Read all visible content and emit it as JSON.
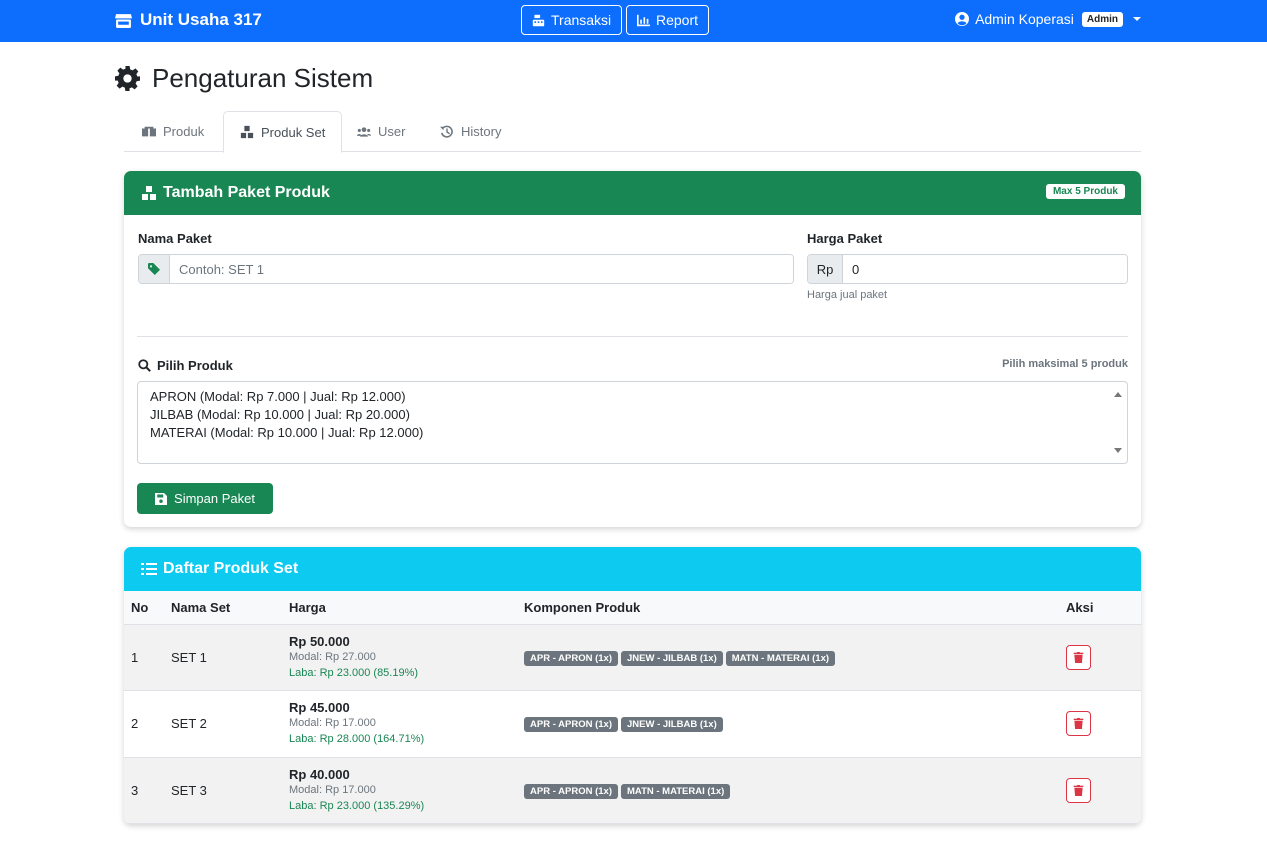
{
  "navbar": {
    "brand": "Unit Usaha 317",
    "transaksi_label": "Transaksi",
    "report_label": "Report",
    "user_name": "Admin Koperasi",
    "user_role": "Admin"
  },
  "page": {
    "title": "Pengaturan Sistem"
  },
  "tabs": [
    {
      "label": "Produk"
    },
    {
      "label": "Produk Set"
    },
    {
      "label": "User"
    },
    {
      "label": "History"
    }
  ],
  "form_card": {
    "title": "Tambah Paket Produk",
    "badge": "Max 5 Produk",
    "nama_label": "Nama Paket",
    "nama_placeholder": "Contoh: SET 1",
    "harga_label": "Harga Paket",
    "harga_prefix": "Rp",
    "harga_value": "0",
    "harga_help": "Harga jual paket",
    "pilih_label": "Pilih Produk",
    "pilih_hint": "Pilih maksimal 5 produk",
    "options": [
      "APRON (Modal: Rp 7.000 | Jual: Rp 12.000)",
      "JILBAB (Modal: Rp 10.000 | Jual: Rp 20.000)",
      "MATERAI (Modal: Rp 10.000 | Jual: Rp 12.000)"
    ],
    "save_label": "Simpan Paket"
  },
  "list_card": {
    "title": "Daftar Produk Set",
    "headers": {
      "no": "No",
      "nama": "Nama Set",
      "harga": "Harga",
      "komponen": "Komponen Produk",
      "aksi": "Aksi"
    },
    "rows": [
      {
        "no": "1",
        "nama": "SET 1",
        "harga": "Rp 50.000",
        "modal": "Modal: Rp 27.000",
        "laba": "Laba: Rp 23.000 (85.19%)",
        "komponen": [
          "APR - APRON (1x)",
          "JNEW - JILBAB (1x)",
          "MATN - MATERAI (1x)"
        ]
      },
      {
        "no": "2",
        "nama": "SET 2",
        "harga": "Rp 45.000",
        "modal": "Modal: Rp 17.000",
        "laba": "Laba: Rp 28.000 (164.71%)",
        "komponen": [
          "APR - APRON (1x)",
          "JNEW - JILBAB (1x)"
        ]
      },
      {
        "no": "3",
        "nama": "SET 3",
        "harga": "Rp 40.000",
        "modal": "Modal: Rp 17.000",
        "laba": "Laba: Rp 23.000 (135.29%)",
        "komponen": [
          "APR - APRON (1x)",
          "MATN - MATERAI (1x)"
        ]
      }
    ]
  },
  "colors": {
    "primary": "#0d6efd",
    "success": "#198754",
    "info": "#0dcaf0",
    "danger": "#dc3545",
    "secondary": "#6c757d"
  }
}
